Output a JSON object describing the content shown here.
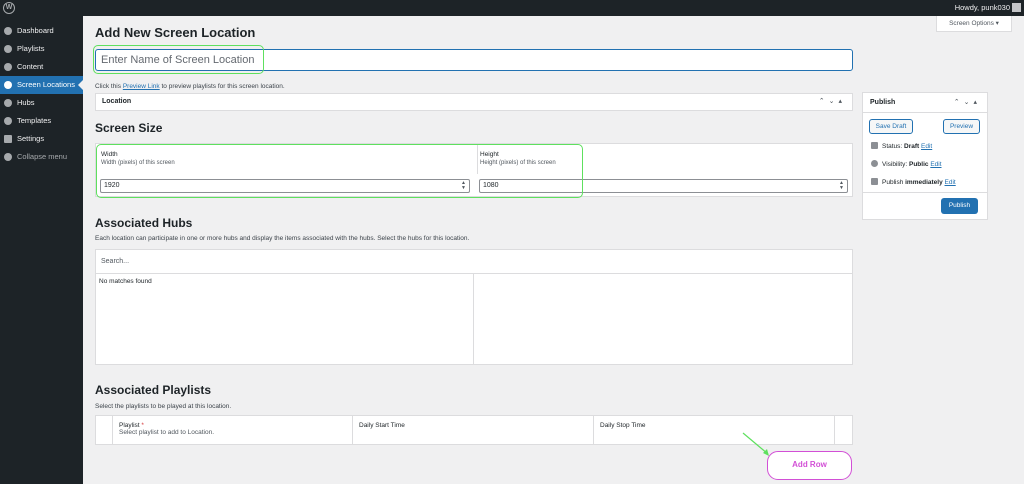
{
  "admin_bar": {
    "howdy": "Howdy, punk030"
  },
  "sidebar": {
    "items": [
      {
        "label": "Dashboard",
        "icon": "dashboard-icon"
      },
      {
        "label": "Playlists",
        "icon": "gear-icon"
      },
      {
        "label": "Content",
        "icon": "gear-icon"
      },
      {
        "label": "Screen Locations",
        "icon": "gear-icon",
        "active": true
      },
      {
        "label": "Hubs",
        "icon": "gear-icon"
      },
      {
        "label": "Templates",
        "icon": "gear-icon"
      },
      {
        "label": "Settings",
        "icon": "settings-icon"
      },
      {
        "label": "Collapse menu",
        "icon": "collapse-icon"
      }
    ]
  },
  "screen_options": "Screen Options ▾",
  "page": {
    "title": "Add New Screen Location",
    "name_placeholder": "Enter Name of Screen Location",
    "preview_prefix": "Click this ",
    "preview_link": "Preview Link",
    "preview_suffix": " to preview playlists for this screen location.",
    "location_label": "Location"
  },
  "screen_size": {
    "heading": "Screen Size",
    "width_label": "Width",
    "width_desc": "Width (pixels) of this screen",
    "width_value": "1920",
    "height_label": "Height",
    "height_desc": "Height (pixels) of this screen",
    "height_value": "1080"
  },
  "hubs": {
    "heading": "Associated Hubs",
    "desc": "Each location can participate in one or more hubs and display the items associated with the hubs. Select the hubs for this location.",
    "search_placeholder": "Search...",
    "no_matches": "No matches found"
  },
  "playlists": {
    "heading": "Associated Playlists",
    "desc": "Select the playlists to be played at this location.",
    "col_playlist": "Playlist",
    "required": "*",
    "col_playlist_desc": "Select playlist to add to Location.",
    "col_start": "Daily Start Time",
    "col_stop": "Daily Stop Time",
    "add_row": "Add Row"
  },
  "publish": {
    "title": "Publish",
    "save_draft": "Save Draft",
    "preview": "Preview",
    "status_label": "Status: ",
    "status_value": "Draft",
    "visibility_label": "Visibility: ",
    "visibility_value": "Public",
    "publish_label": "Publish ",
    "publish_value": "immediately",
    "edit": "Edit",
    "publish_button": "Publish"
  },
  "colors": {
    "accent": "#2271b1",
    "sidebar": "#1d2327",
    "annotation_green": "#5ee05e",
    "annotation_magenta": "#d24fd6"
  }
}
